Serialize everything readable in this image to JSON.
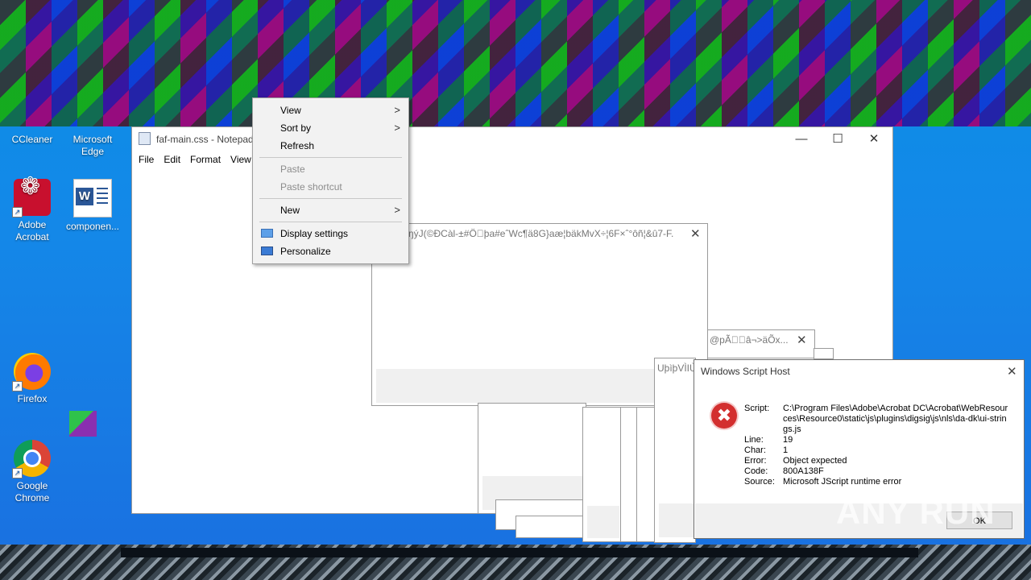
{
  "desktop": {
    "icons": [
      {
        "label": "CCleaner"
      },
      {
        "label": "Microsoft Edge"
      },
      {
        "label": "Adobe Acrobat"
      },
      {
        "label": "componen..."
      },
      {
        "label": "Firefox"
      },
      {
        "label": "Google Chrome"
      }
    ]
  },
  "notepad": {
    "title": "faf-main.css - Notepad",
    "menu": [
      "File",
      "Edit",
      "Format",
      "View"
    ],
    "controls": {
      "minimize": "—",
      "maximize": "☐",
      "close": "✕"
    }
  },
  "context_menu": {
    "items": [
      {
        "label": "View",
        "submenu": true,
        "enabled": true
      },
      {
        "label": "Sort by",
        "submenu": true,
        "enabled": true
      },
      {
        "label": "Refresh",
        "submenu": false,
        "enabled": true
      },
      {
        "label": "Paste",
        "submenu": false,
        "enabled": false
      },
      {
        "label": "Paste shortcut",
        "submenu": false,
        "enabled": false
      },
      {
        "label": "New",
        "submenu": true,
        "enabled": true
      },
      {
        "label": "Display settings",
        "submenu": false,
        "enabled": true,
        "icon": "display-icon"
      },
      {
        "label": "Personalize",
        "submenu": false,
        "enabled": true,
        "icon": "personalize-icon"
      }
    ]
  },
  "popups": {
    "popup1_title": "ŋýJ(©ÐCàl-±#Ö\u0000þa#eˆWc¶ä8G}aæ¦bäkMvX÷¦6F×ˆ°ôñ¦&û7-F...",
    "popup2_title": "@pÃ\u0000\u0000â¬>äÕx...",
    "popup3_title": "UþìþVÌIÙ"
  },
  "wsh_dialog": {
    "title": "Windows Script Host",
    "fields": {
      "script_label": "Script:",
      "script_value": "C:\\Program Files\\Adobe\\Acrobat DC\\Acrobat\\WebResources\\Resource0\\static\\js\\plugins\\digsig\\js\\nls\\da-dk\\ui-strings.js",
      "line_label": "Line:",
      "line_value": "19",
      "char_label": "Char:",
      "char_value": "1",
      "error_label": "Error:",
      "error_value": "Object expected",
      "code_label": "Code:",
      "code_value": "800A138F",
      "source_label": "Source:",
      "source_value": "Microsoft JScript runtime error"
    },
    "ok_label": "OK"
  },
  "watermark": "ANY RUN"
}
